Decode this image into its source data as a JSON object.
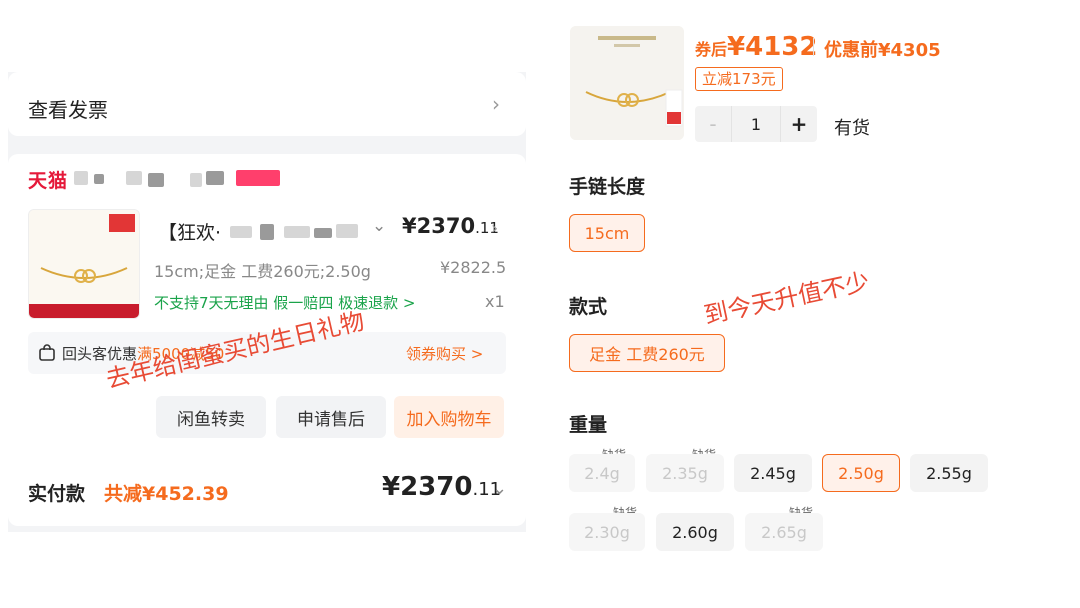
{
  "invoice": {
    "title": "查看发票"
  },
  "order": {
    "shop_logo": "天猫",
    "product_title": "【狂欢·",
    "price_main": "¥2370",
    "price_cents": ".11",
    "spec": "15cm;足金 工费260元;2.50g",
    "original_price": "¥2822.5",
    "services": "不支持7天无理由 假一赔四 极速退款 >",
    "quantity": "x1",
    "promo_prefix": "回头客优惠",
    "promo_highlight": "满5000减50",
    "promo_action": "领券购买 >",
    "buttons": {
      "resell": "闲鱼转卖",
      "after_sale": "申请售后",
      "add_cart": "加入购物车"
    },
    "paid_label": "实付款",
    "paid_discount": "共减¥452.39",
    "paid_main": "¥2370",
    "paid_cents": ".11"
  },
  "annotations": {
    "gift": "去年给闺蜜买的生日礼物",
    "rise": "到今天升值不少"
  },
  "sku": {
    "after_label": "券后",
    "after_price": "¥4132",
    "before_label": "优惠前",
    "before_price": "¥4305",
    "instant_off": "立减173元",
    "quantity": "1",
    "stock": "有货",
    "sections": {
      "length": {
        "title": "手链长度",
        "options": [
          "15cm"
        ],
        "selected": "15cm"
      },
      "style": {
        "title": "款式",
        "options": [
          "足金 工费260元"
        ],
        "selected": "足金 工费260元"
      },
      "weight": {
        "title": "重量",
        "out_of_stock_label": "缺货",
        "options": [
          {
            "label": "2.4g",
            "state": "out_of_stock"
          },
          {
            "label": "2.35g",
            "state": "out_of_stock"
          },
          {
            "label": "2.45g",
            "state": "available"
          },
          {
            "label": "2.50g",
            "state": "selected"
          },
          {
            "label": "2.55g",
            "state": "available"
          },
          {
            "label": "2.30g",
            "state": "out_of_stock"
          },
          {
            "label": "2.60g",
            "state": "available"
          },
          {
            "label": "2.65g",
            "state": "out_of_stock"
          }
        ]
      }
    }
  },
  "colors": {
    "accent": "#f56b1e",
    "tmall_red": "#e5193a",
    "service_green": "#1aa34a",
    "annotation_red": "#e84b35"
  }
}
